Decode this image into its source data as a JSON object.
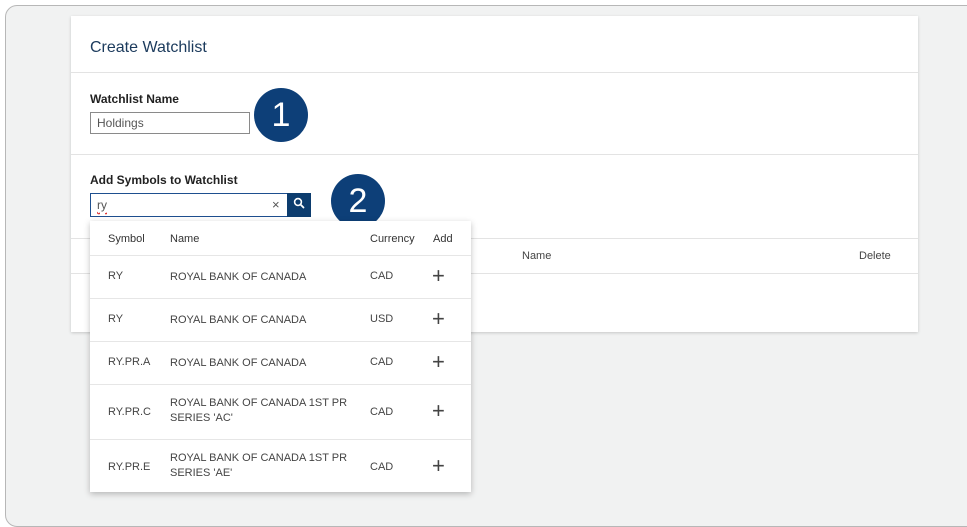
{
  "card": {
    "title": "Create Watchlist",
    "watchlist_name_label": "Watchlist Name",
    "watchlist_name_value": "Holdings",
    "add_symbols_label": "Add Symbols to Watchlist",
    "search_value": "ry",
    "clear_glyph": "×",
    "table_headers": {
      "name": "Name",
      "delete": "Delete"
    }
  },
  "callouts": {
    "one": "1",
    "two": "2"
  },
  "dropdown": {
    "headers": {
      "symbol": "Symbol",
      "name": "Name",
      "currency": "Currency",
      "add": "Add"
    },
    "add_glyph": "+",
    "rows": [
      {
        "symbol": "RY",
        "name": "ROYAL BANK OF CANADA",
        "currency": "CAD"
      },
      {
        "symbol": "RY",
        "name": "ROYAL BANK OF CANADA",
        "currency": "USD"
      },
      {
        "symbol": "RY.PR.A",
        "name": "ROYAL BANK OF CANADA",
        "currency": "CAD"
      },
      {
        "symbol": "RY.PR.C",
        "name": "ROYAL BANK OF CANADA 1ST PR SERIES 'AC'",
        "currency": "CAD"
      },
      {
        "symbol": "RY.PR.E",
        "name": "ROYAL BANK OF CANADA 1ST PR SERIES 'AE'",
        "currency": "CAD"
      }
    ]
  },
  "icons": {
    "search": "search-icon",
    "clear": "close-icon",
    "add": "plus-icon"
  },
  "colors": {
    "brand": "#0d3f78",
    "search_button": "#0c3c6e",
    "title": "#1b3a5c"
  }
}
